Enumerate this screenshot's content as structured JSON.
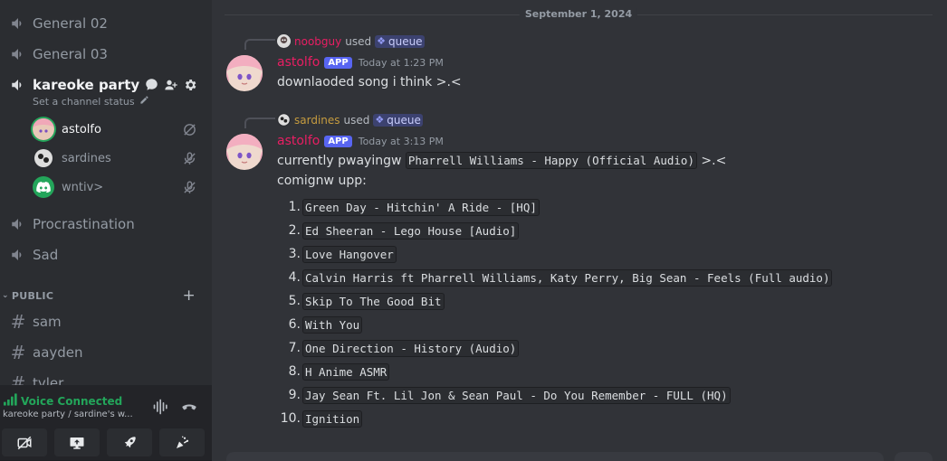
{
  "sidebar": {
    "channels_top": [
      {
        "name": "General 02"
      },
      {
        "name": "General 03"
      }
    ],
    "active_channel": {
      "name": "kareoke party",
      "status_placeholder": "Set a channel status"
    },
    "voice_users": [
      {
        "name": "astolfo",
        "speaking": true
      },
      {
        "name": "sardines",
        "speaking": false
      },
      {
        "name": "wntiv>",
        "speaking": false
      }
    ],
    "channels_bottom": [
      {
        "name": "Procrastination"
      },
      {
        "name": "Sad"
      }
    ],
    "category": {
      "name": "PUBLIC"
    },
    "text_channels": [
      {
        "name": "sam"
      },
      {
        "name": "aayden"
      },
      {
        "name": "tyler"
      }
    ]
  },
  "voice_panel": {
    "status": "Voice Connected",
    "subtitle": "kareoke party / sardine's w...",
    "status_color": "#23a55a"
  },
  "chat": {
    "date_divider": "September 1, 2024",
    "messages": [
      {
        "reply_user": "noobguy",
        "reply_user_color": "#e91e63",
        "used_text": "used",
        "command": "queue",
        "author": "astolfo",
        "badge": "APP",
        "time": "Today at 1:23 PM",
        "text": "downlaoded song i think >.<"
      },
      {
        "reply_user": "sardines",
        "reply_user_color": "#c69c3f",
        "used_text": "used",
        "command": "queue",
        "author": "astolfo",
        "badge": "APP",
        "time": "Today at 3:13 PM",
        "line1_prefix": "currently pwayingw",
        "now_playing": "Pharrell Williams - Happy (Official Audio)",
        "line1_suffix": ">.<",
        "line2": "comignw upp:",
        "queue": [
          "Green Day - Hitchin' A Ride - [HQ]",
          "Ed Sheeran - Lego House [Audio]",
          "Love Hangover",
          "Calvin Harris ft Pharrell Williams, Katy Perry, Big Sean - Feels (Full audio)",
          "Skip To The Good Bit",
          "With You",
          "One Direction - History (Audio)",
          "H Anime ASMR",
          "Jay Sean Ft. Lil Jon & Sean Paul - Do You Remember - FULL (HQ)",
          "Ignition"
        ]
      }
    ]
  },
  "colors": {
    "accent": "#5865f2",
    "author_name": "#e91e63"
  }
}
